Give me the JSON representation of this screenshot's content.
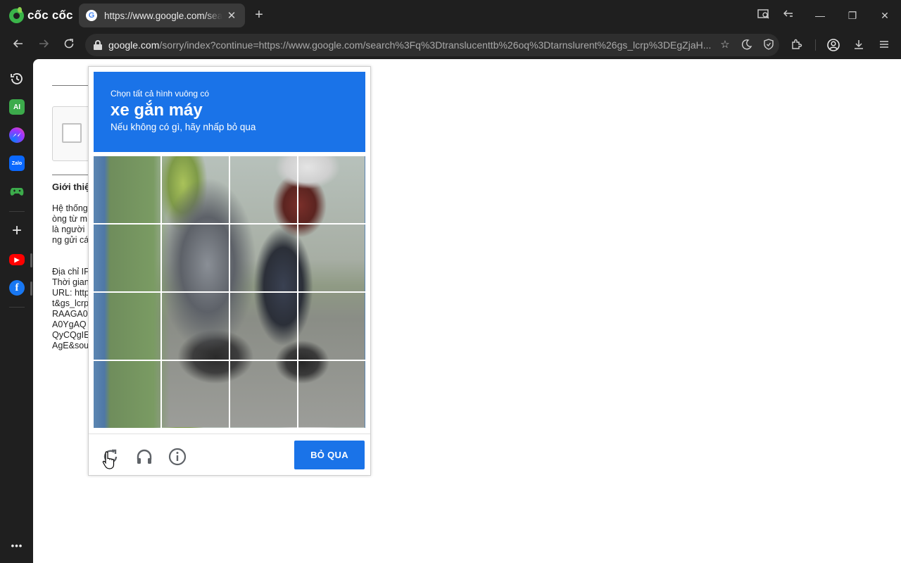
{
  "browser": {
    "brand": "cốc cốc",
    "tab": {
      "title": "https://www.google.com/search?q=translucenttb",
      "close": "✕",
      "favicon_letter": "G"
    },
    "new_tab": "+",
    "window_controls": {
      "minimize": "—",
      "restore": "❐",
      "close": "✕"
    },
    "url": {
      "host": "google.com",
      "rest": "/sorry/index?continue=https://www.google.com/search%3Fq%3Dtranslucenttb%26oq%3Dtarnslurent%26gs_lcrp%3DEgZjaH..."
    }
  },
  "sidebar": {
    "items": [
      {
        "name": "history",
        "label": ""
      },
      {
        "name": "ai",
        "label": "AI"
      },
      {
        "name": "messenger",
        "label": ""
      },
      {
        "name": "zalo",
        "label": "Zalo"
      },
      {
        "name": "games",
        "label": ""
      },
      {
        "name": "add",
        "label": "+"
      },
      {
        "name": "youtube",
        "label": "▶"
      },
      {
        "name": "facebook",
        "label": "f"
      }
    ],
    "more": "•••"
  },
  "page": {
    "heading": "Giới thiệ",
    "para1": [
      "Hệ thống",
      "òng từ m",
      "là người",
      "ng gửi cá"
    ],
    "para2": [
      "Địa chỉ IF",
      "Thời gian",
      "URL: http",
      "t&gs_lcrp",
      "RAAGA0",
      "A0YgAQ",
      "QyCQgIE",
      "AgE&sou"
    ]
  },
  "captcha": {
    "prompt": "Chọn tất cả hình vuông có",
    "object": "xe gắn máy",
    "subtitle": "Nếu không có gì, hãy nhấp bỏ qua",
    "rows": 4,
    "cols": 4,
    "skip_label": "BỎ QUA",
    "colors": {
      "accent": "#1a73e8"
    }
  }
}
